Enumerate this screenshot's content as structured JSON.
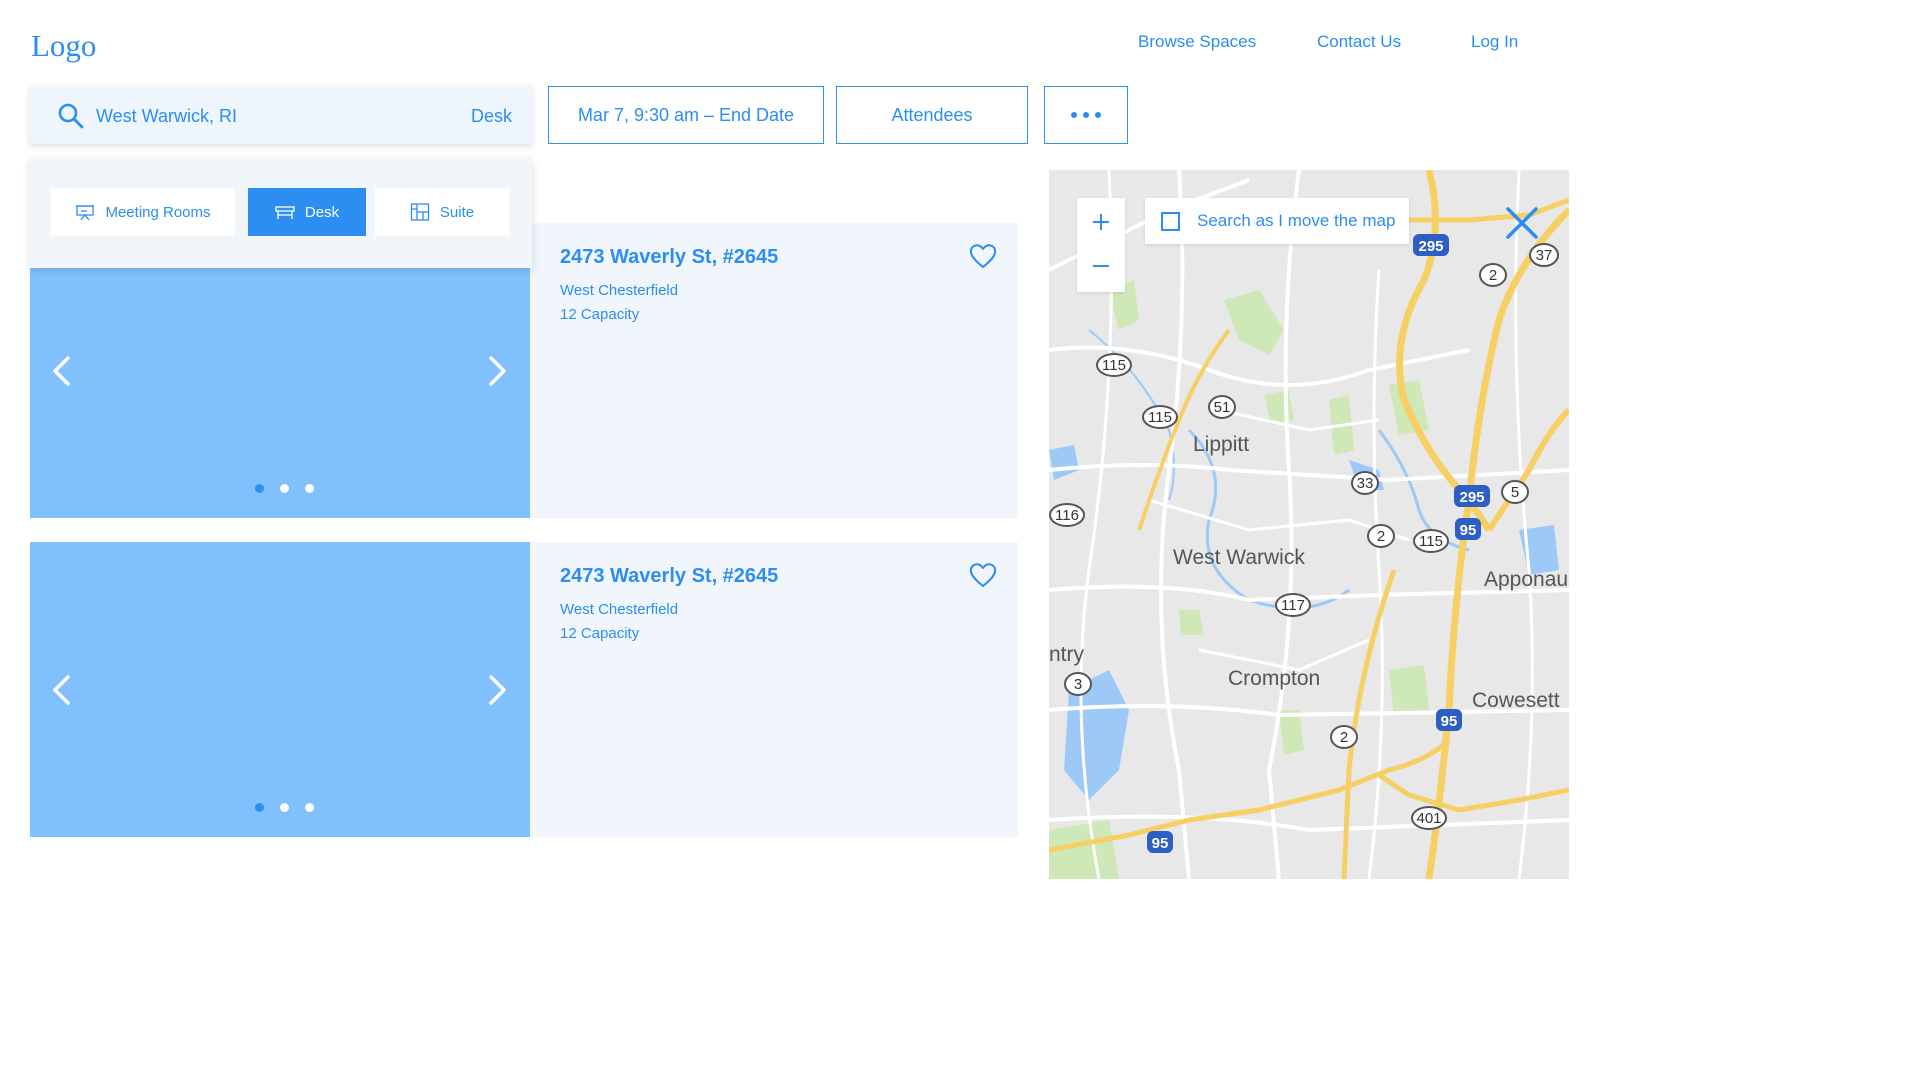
{
  "header": {
    "logo": "Logo",
    "nav": [
      "Browse Spaces",
      "Contact Us",
      "Log In"
    ]
  },
  "search": {
    "location": "West Warwick, RI",
    "type": "Desk"
  },
  "filters": {
    "date": "Mar 7, 9:30 am – End Date",
    "attendees": "Attendees"
  },
  "space_types": [
    {
      "label": "Meeting Rooms",
      "icon": "presentation-icon"
    },
    {
      "label": "Desk",
      "icon": "desk-icon"
    },
    {
      "label": "Suite",
      "icon": "floorplan-icon"
    }
  ],
  "selected_space_type": "Desk",
  "listings": [
    {
      "title": "2473 Waverly St, #2645",
      "location": "West Chesterfield",
      "capacity": "12 Capacity",
      "photo_count": 3,
      "active_photo": 1
    },
    {
      "title": "2473 Waverly St, #2645",
      "location": "West Chesterfield",
      "capacity": "12 Capacity",
      "photo_count": 3,
      "active_photo": 1
    }
  ],
  "map": {
    "search_as_move": "Search as I move the map",
    "search_as_move_checked": false,
    "place_labels": [
      "Lippitt",
      "West Warwick",
      "Crompton",
      "ntry",
      "Apponau",
      "Cowesett"
    ],
    "route_shields": [
      "295",
      "2",
      "37",
      "115",
      "51",
      "115",
      "33",
      "295",
      "5",
      "116",
      "95",
      "2",
      "115",
      "117",
      "3",
      "95",
      "2",
      "401",
      "95"
    ]
  },
  "colors": {
    "accent": "#2b8ef0",
    "photo_placeholder": "#80c1fd",
    "card_background": "#f0f6fc",
    "map_background": "#e8e8e8",
    "road_major": "#f6cf65"
  }
}
